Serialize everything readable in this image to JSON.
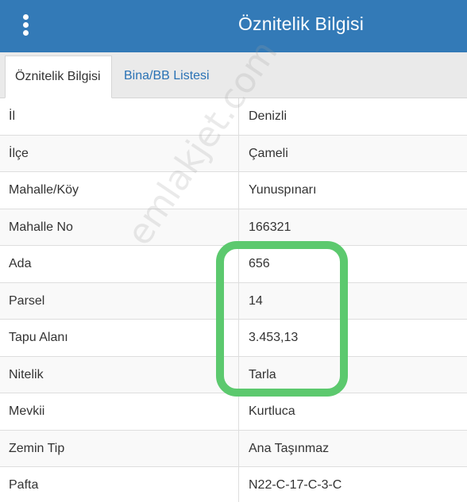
{
  "header": {
    "title": "Öznitelik Bilgisi",
    "menu_icon": "vertical-dots-icon",
    "background_color": "#337ab7"
  },
  "tabs": [
    {
      "label": "Öznitelik Bilgisi",
      "active": true
    },
    {
      "label": "Bina/BB Listesi",
      "active": false
    }
  ],
  "rows": [
    {
      "key": "İl",
      "value": "Denizli"
    },
    {
      "key": "İlçe",
      "value": "Çameli"
    },
    {
      "key": "Mahalle/Köy",
      "value": "Yunuspınarı"
    },
    {
      "key": "Mahalle No",
      "value": "166321"
    },
    {
      "key": "Ada",
      "value": "656"
    },
    {
      "key": "Parsel",
      "value": "14"
    },
    {
      "key": "Tapu Alanı",
      "value": "3.453,13"
    },
    {
      "key": "Nitelik",
      "value": "Tarla"
    },
    {
      "key": "Mevkii",
      "value": "Kurtluca"
    },
    {
      "key": "Zemin Tip",
      "value": "Ana Taşınmaz"
    },
    {
      "key": "Pafta",
      "value": "N22-C-17-C-3-C"
    }
  ],
  "watermark": "emlakjet.com",
  "highlight_color": "#5cc96e"
}
